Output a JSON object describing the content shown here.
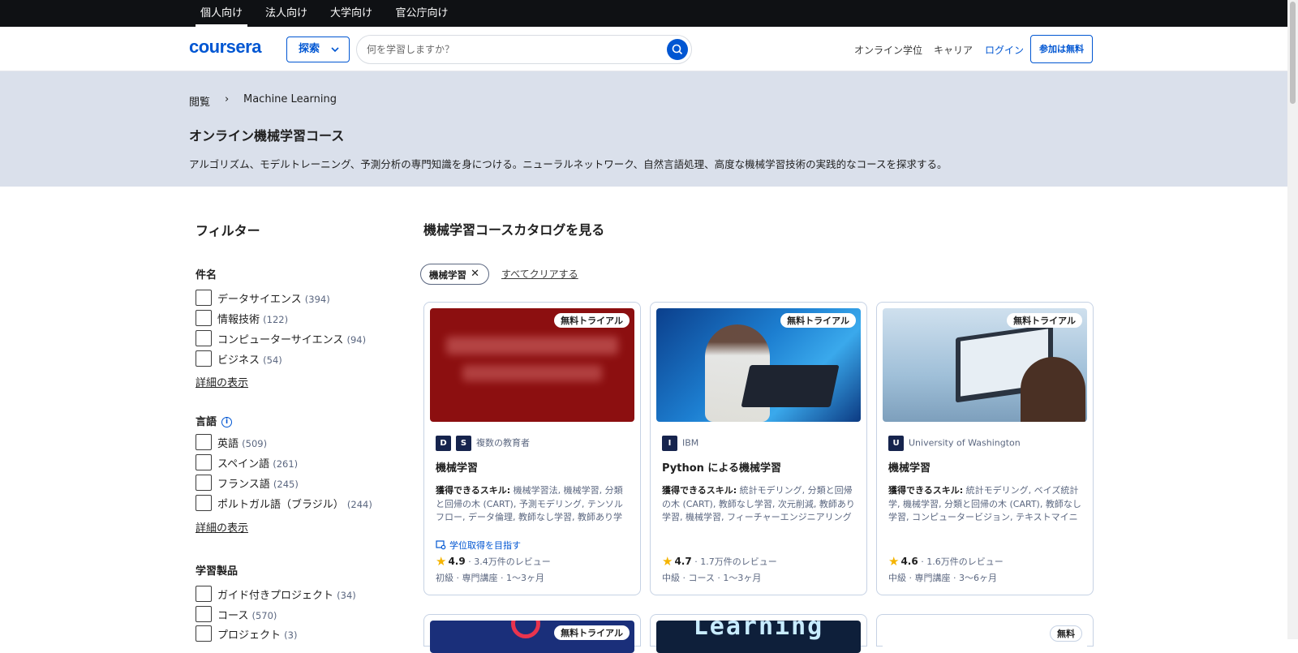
{
  "topbar": {
    "tabs": [
      "個人向け",
      "法人向け",
      "大学向け",
      "官公庁向け"
    ]
  },
  "header": {
    "logo": "coursera",
    "explore": "探索",
    "search_placeholder": "何を学習しますか？",
    "links": [
      "オンライン学位",
      "キャリア",
      "ログイン"
    ],
    "join": "参加は無料"
  },
  "hero": {
    "breadcrumb": [
      "閲覧",
      "›",
      "Machine Learning"
    ],
    "title": "オンライン機械学習コース",
    "description": "アルゴリズム、モデルトレーニング、予測分析の専門知識を身につける。ニューラルネットワーク、自然言語処理、高度な機械学習技術の実践的なコースを探求する。"
  },
  "filters": {
    "title": "フィルター",
    "groups": [
      {
        "title": "件名",
        "items": [
          {
            "label": "データサイエンス",
            "count": "(394)"
          },
          {
            "label": "情報技術",
            "count": "(122)"
          },
          {
            "label": "コンピューターサイエンス",
            "count": "(94)"
          },
          {
            "label": "ビジネス",
            "count": "(54)"
          }
        ],
        "more": "詳細の表示"
      },
      {
        "title": "言語",
        "items": [
          {
            "label": "英語",
            "count": "(509)"
          },
          {
            "label": "スペイン語",
            "count": "(261)"
          },
          {
            "label": "フランス語",
            "count": "(245)"
          },
          {
            "label": "ポルトガル語（ブラジル）",
            "count": "(244)"
          }
        ],
        "more": "詳細の表示"
      },
      {
        "title": "学習製品",
        "items": [
          {
            "label": "ガイド付きプロジェクト",
            "count": "(34)"
          },
          {
            "label": "コース",
            "count": "(570)"
          },
          {
            "label": "プロジェクト",
            "count": "(3)"
          }
        ]
      }
    ]
  },
  "catalog": {
    "title": "機械学習コースカタログを見る",
    "chip": "機械学習",
    "clear": "すべてクリアする",
    "cards": [
      {
        "badge": "無料トライアル",
        "logos": [
          "D",
          "S"
        ],
        "org": "複数の教育者",
        "title": "機械学習",
        "skills_label": "獲得できるスキル:",
        "skills": " 機械学習法, 機械学習, 分類と回帰の木 (CART), 予測モデリング, テンソルフロー, データ倫理, 教師なし学習, 教師あり学習",
        "degree": "学位取得を目指す",
        "rating": "4.9",
        "reviews": "· 3.4万件のレビュー",
        "meta": "初級 · 専門講座 · 1～3ヶ月"
      },
      {
        "badge": "無料トライアル",
        "logos": [
          "I"
        ],
        "org": "IBM",
        "title": "Python による機械学習",
        "skills_label": "獲得できるスキル:",
        "skills": " 統計モデリング, 分類と回帰の木 (CART), 教師なし学習, 次元削減, 教師あり学習, 機械学習, フィーチャーエンジニアリング",
        "degree": "",
        "rating": "4.7",
        "reviews": "· 1.7万件のレビュー",
        "meta": "中級 · コース · 1～3ヶ月"
      },
      {
        "badge": "無料トライアル",
        "logos": [
          "U"
        ],
        "org": "University of Washington",
        "title": "機械学習",
        "skills_label": "獲得できるスキル:",
        "skills": " 統計モデリング, ベイズ統計学, 機械学習, 分類と回帰の木 (CART), 教師なし学習, コンピュータービジョン, テキストマイニング",
        "degree": "",
        "rating": "4.6",
        "reviews": "· 1.6万件のレビュー",
        "meta": "中級 · 専門講座 · 3～6ヶ月"
      }
    ],
    "row2_badges": [
      "無料トライアル",
      "",
      "無料"
    ],
    "row2_image_text": "Learning"
  }
}
